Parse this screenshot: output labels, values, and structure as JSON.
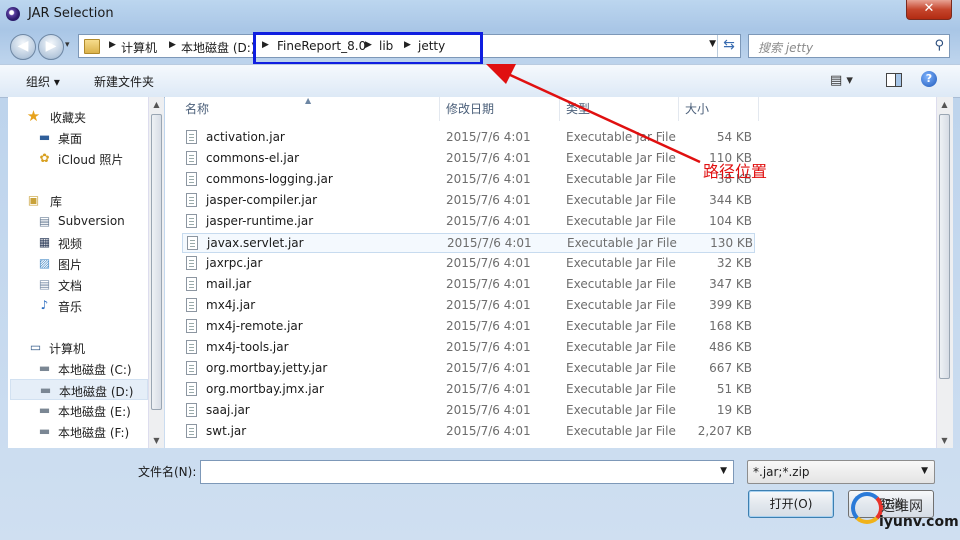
{
  "window": {
    "title": "JAR Selection",
    "close_glyph": "✕"
  },
  "address": {
    "crumbs": [
      "计算机",
      "本地磁盘 (D:)",
      "FineReport_8.0",
      "lib",
      "jetty"
    ],
    "search_placeholder": "搜索 jetty"
  },
  "toolbar": {
    "organize_label": "组织 ▾",
    "new_folder_label": "新建文件夹",
    "view_label": "▤ ▾",
    "help_label": "?"
  },
  "nav": {
    "items": [
      {
        "label": "收藏夹",
        "icon": "star-icon",
        "glyph": "★",
        "color": "#e7a21c"
      },
      {
        "label": "桌面",
        "icon": "desktop-icon",
        "glyph": "▬",
        "color": "#2f5f9a"
      },
      {
        "label": "iCloud 照片",
        "icon": "icloud-photos-icon",
        "glyph": "✿",
        "color": "#d8a020"
      },
      {
        "label": "库",
        "icon": "library-icon",
        "glyph": "▣",
        "color": "#c9a23a"
      },
      {
        "label": "Subversion",
        "icon": "subversion-icon",
        "glyph": "▤",
        "color": "#6a7e96"
      },
      {
        "label": "视频",
        "icon": "video-icon",
        "glyph": "▦",
        "color": "#2d3c5a"
      },
      {
        "label": "图片",
        "icon": "pictures-icon",
        "glyph": "▨",
        "color": "#4e8fc8"
      },
      {
        "label": "文档",
        "icon": "documents-icon",
        "glyph": "▤",
        "color": "#7a8ea8"
      },
      {
        "label": "音乐",
        "icon": "music-icon",
        "glyph": "♪",
        "color": "#2b6cc0"
      },
      {
        "label": "计算机",
        "icon": "computer-icon",
        "glyph": "▭",
        "color": "#3a5f8c"
      },
      {
        "label": "本地磁盘 (C:)",
        "icon": "drive-icon",
        "glyph": "▬",
        "color": "#7b8794"
      },
      {
        "label": "本地磁盘 (D:)",
        "icon": "drive-icon",
        "glyph": "▬",
        "color": "#7b8794"
      },
      {
        "label": "本地磁盘 (E:)",
        "icon": "drive-icon",
        "glyph": "▬",
        "color": "#7b8794"
      },
      {
        "label": "本地磁盘 (F:)",
        "icon": "drive-icon",
        "glyph": "▬",
        "color": "#7b8794"
      }
    ]
  },
  "columns": {
    "name": "名称",
    "date": "修改日期",
    "type": "类型",
    "size": "大小"
  },
  "files": [
    {
      "name": "activation.jar",
      "date": "2015/7/6 4:01",
      "type": "Executable Jar File",
      "size": "54 KB"
    },
    {
      "name": "commons-el.jar",
      "date": "2015/7/6 4:01",
      "type": "Executable Jar File",
      "size": "110 KB"
    },
    {
      "name": "commons-logging.jar",
      "date": "2015/7/6 4:01",
      "type": "Executable Jar File",
      "size": "38 KB"
    },
    {
      "name": "jasper-compiler.jar",
      "date": "2015/7/6 4:01",
      "type": "Executable Jar File",
      "size": "344 KB"
    },
    {
      "name": "jasper-runtime.jar",
      "date": "2015/7/6 4:01",
      "type": "Executable Jar File",
      "size": "104 KB"
    },
    {
      "name": "javax.servlet.jar",
      "date": "2015/7/6 4:01",
      "type": "Executable Jar File",
      "size": "130 KB"
    },
    {
      "name": "jaxrpc.jar",
      "date": "2015/7/6 4:01",
      "type": "Executable Jar File",
      "size": "32 KB"
    },
    {
      "name": "mail.jar",
      "date": "2015/7/6 4:01",
      "type": "Executable Jar File",
      "size": "347 KB"
    },
    {
      "name": "mx4j.jar",
      "date": "2015/7/6 4:01",
      "type": "Executable Jar File",
      "size": "399 KB"
    },
    {
      "name": "mx4j-remote.jar",
      "date": "2015/7/6 4:01",
      "type": "Executable Jar File",
      "size": "168 KB"
    },
    {
      "name": "mx4j-tools.jar",
      "date": "2015/7/6 4:01",
      "type": "Executable Jar File",
      "size": "486 KB"
    },
    {
      "name": "org.mortbay.jetty.jar",
      "date": "2015/7/6 4:01",
      "type": "Executable Jar File",
      "size": "667 KB"
    },
    {
      "name": "org.mortbay.jmx.jar",
      "date": "2015/7/6 4:01",
      "type": "Executable Jar File",
      "size": "51 KB"
    },
    {
      "name": "saaj.jar",
      "date": "2015/7/6 4:01",
      "type": "Executable Jar File",
      "size": "19 KB"
    },
    {
      "name": "swt.jar",
      "date": "2015/7/6 4:01",
      "type": "Executable Jar File",
      "size": "2,207 KB"
    }
  ],
  "annotation": {
    "label": "路径位置",
    "color": "#e01010"
  },
  "bottom": {
    "filename_label": "文件名(N):",
    "filename_value": "",
    "filter_value": "*.jar;*.zip",
    "open_label": "打开(O)",
    "cancel_label": "取消"
  },
  "watermark": {
    "line1": "运维网",
    "line2": "iyunv.com"
  }
}
